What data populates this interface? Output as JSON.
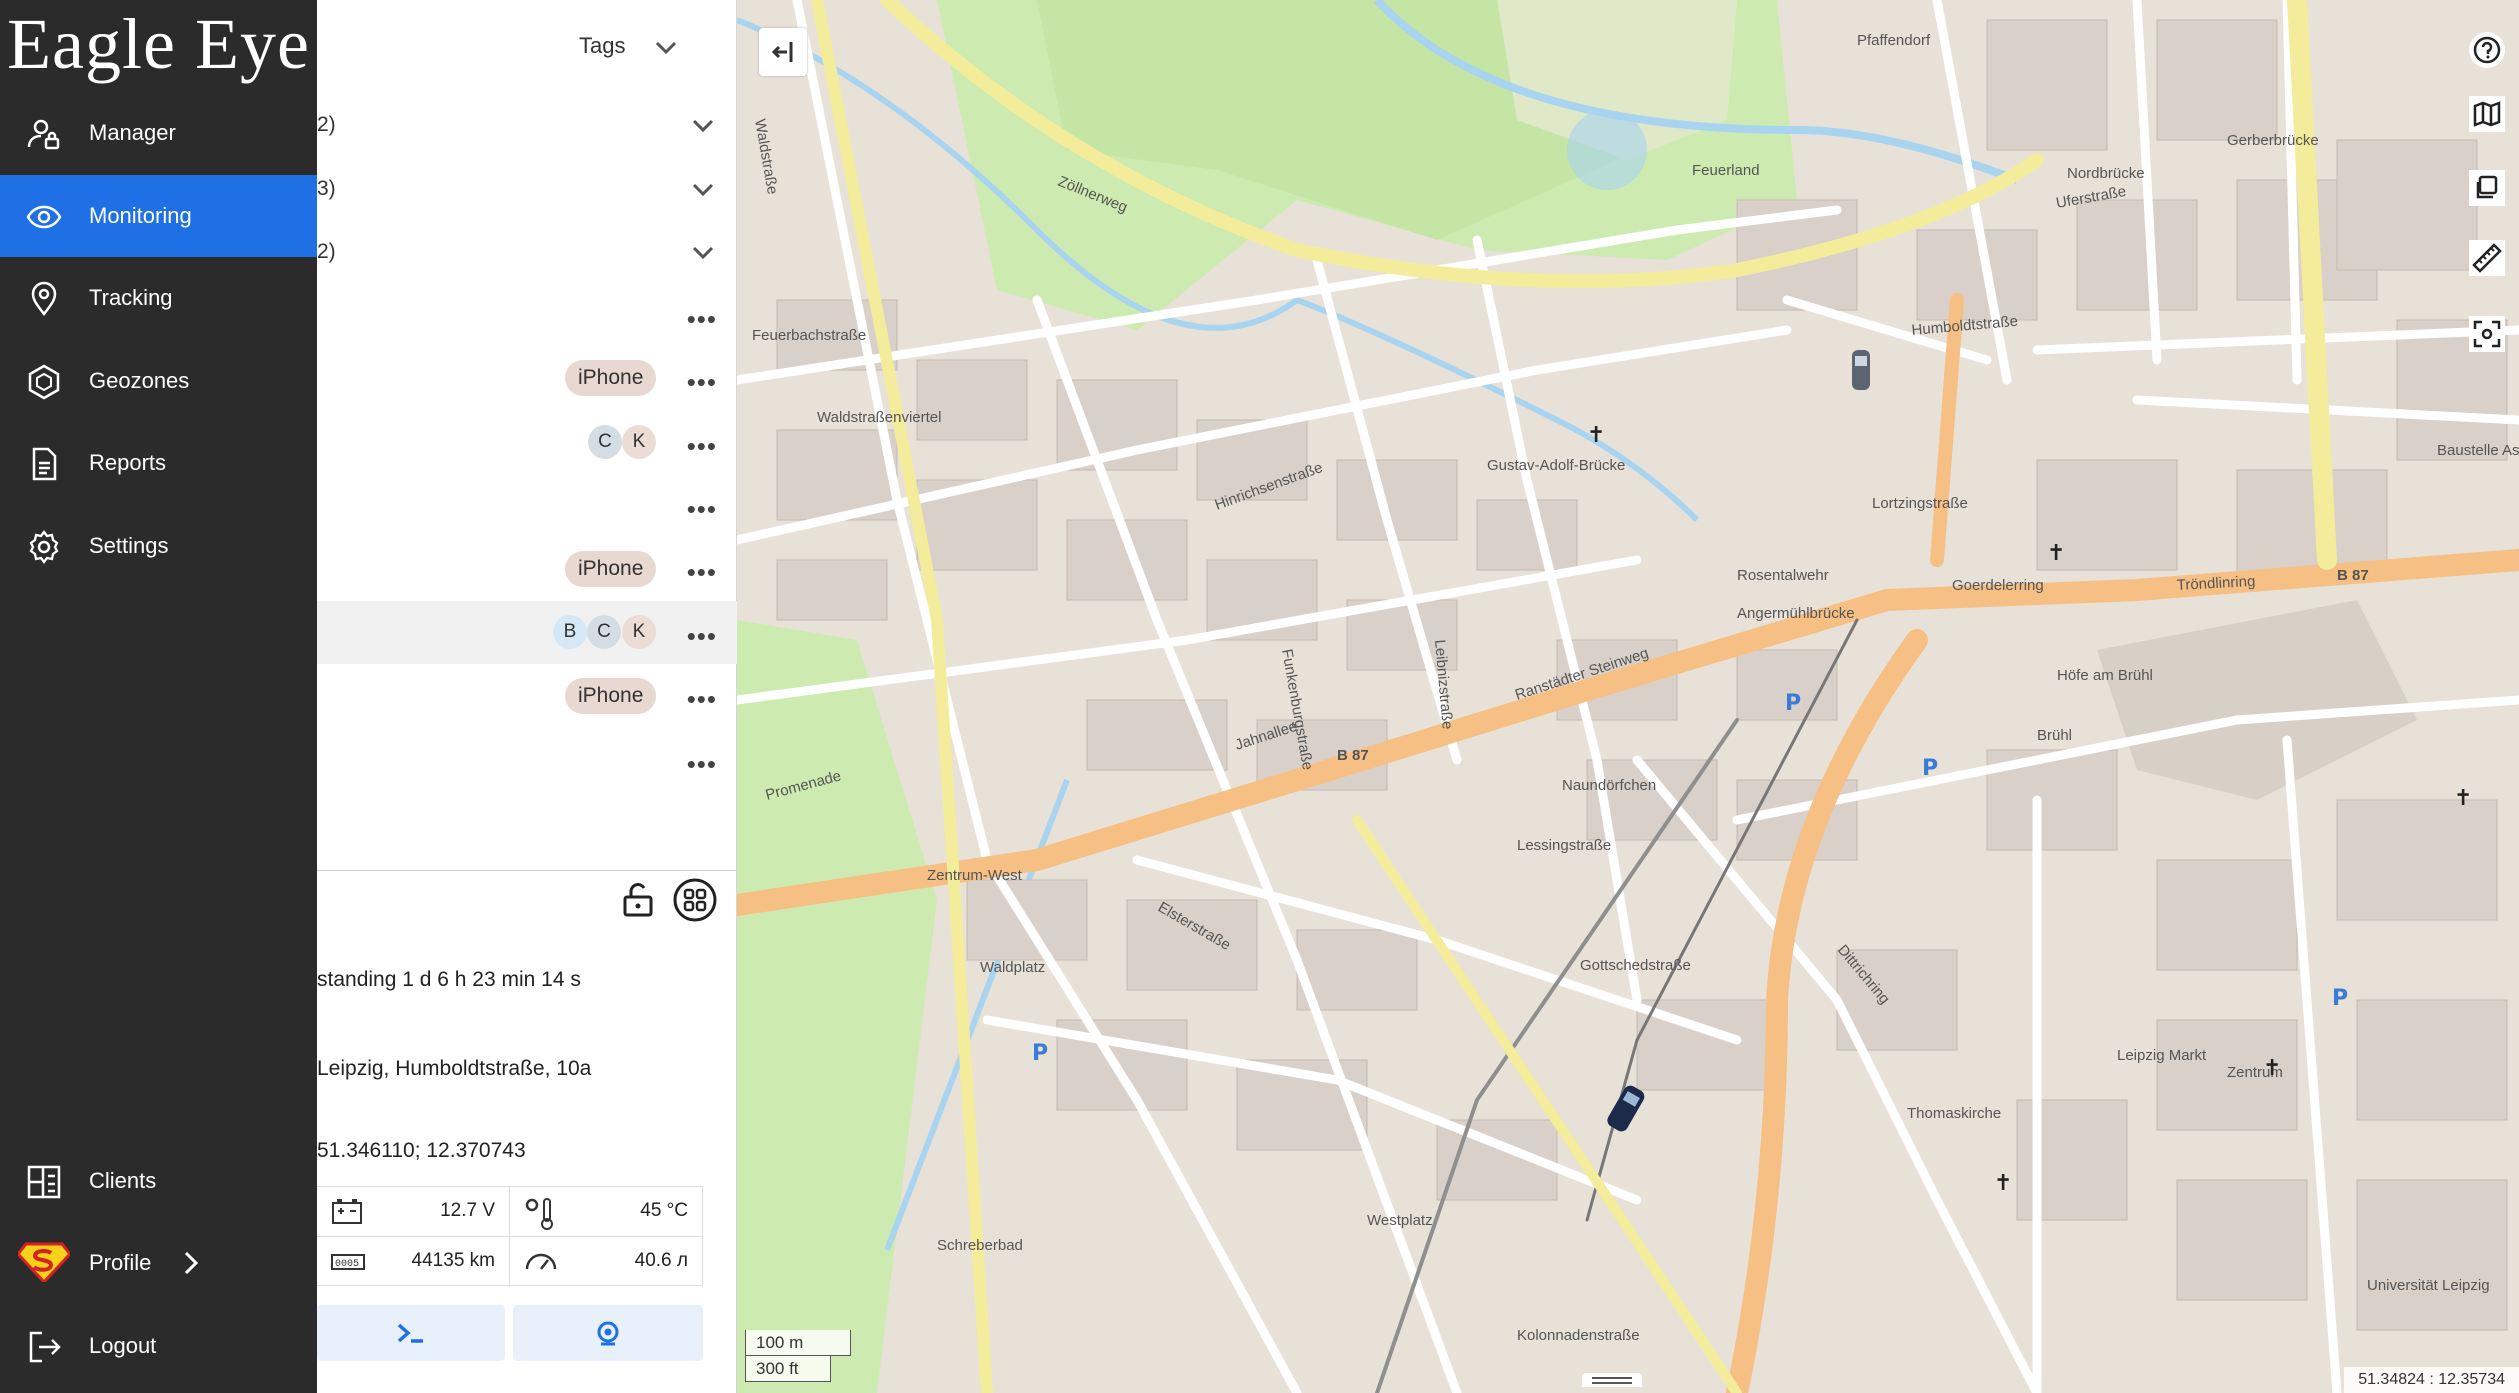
{
  "app": {
    "logo": "Eagle Eye"
  },
  "nav": {
    "items": [
      {
        "label": "Manager",
        "icon": "user-lock-icon"
      },
      {
        "label": "Monitoring",
        "icon": "eye-icon"
      },
      {
        "label": "Tracking",
        "icon": "map-pin-icon"
      },
      {
        "label": "Geozones",
        "icon": "hexagon-icon"
      },
      {
        "label": "Reports",
        "icon": "document-icon"
      },
      {
        "label": "Settings",
        "icon": "gear-icon"
      }
    ],
    "bottom": [
      {
        "label": "Clients",
        "icon": "clients-icon"
      },
      {
        "label": "Profile",
        "icon": "superman-avatar-icon"
      },
      {
        "label": "Logout",
        "icon": "logout-icon"
      }
    ],
    "active_color": "#1f6fe5"
  },
  "panel": {
    "tags_label": "Tags",
    "groups": [
      {
        "label": "2)"
      },
      {
        "label": "3)"
      },
      {
        "label": "2)"
      }
    ],
    "rows": [
      {
        "chips": []
      },
      {
        "chip": "iPhone"
      },
      {
        "avatars": [
          "C",
          "K"
        ]
      },
      {
        "chips": []
      },
      {
        "chip": "iPhone"
      },
      {
        "avatars": [
          "B",
          "C",
          "K"
        ],
        "selected": true
      },
      {
        "chip": "iPhone"
      },
      {
        "chips": []
      }
    ],
    "details": {
      "status": "standing 1 d 6 h 23 min 14 s",
      "address": "Leipzig, Humboldtstraße, 10a",
      "coords": "51.346110; 12.370743"
    },
    "metrics": {
      "voltage": "12.7 V",
      "temperature": "45 °C",
      "odometer": "44135 km",
      "fuel": "40.6 л"
    }
  },
  "map": {
    "scale_m": "100 m",
    "scale_ft": "300 ft",
    "cursor_coords": "51.34824 : 12.35734",
    "labels": {
      "zollnerweg": "Zöllnerweg",
      "waldstrassenviertel": "Waldstraßenviertel",
      "gustav_adolf_bruecke": "Gustav-Adolf-Brücke",
      "jahnallee": "Jahnallee",
      "b87": "B 87",
      "troendlinring": "Tröndlinring",
      "goerdelerring": "Goerdelerring",
      "leibnizstrasse": "Leibnizstraße",
      "zentrum": "Zentrum",
      "leipzig_markt": "Leipzig Markt",
      "thomaskirche": "Thomaskirche",
      "pfaffendorf": "Pfaffendorf",
      "feuerland": "Feuerland",
      "naundorfchen": "Naundörfchen",
      "waldplatz": "Waldplatz",
      "westplatz": "Westplatz",
      "gottschedstrasse": "Gottschedstraße",
      "dittrichring": "Dittrichring",
      "ranstaedter_steinweg": "Ranstädter Steinweg",
      "lessingstrasse": "Lessingstraße",
      "humboldtstrasse": "Humboldtstraße",
      "rosentalwehr": "Rosentalwehr",
      "lortzingstrasse": "Lortzingstraße",
      "bruehl": "Brühl",
      "gerberbruecke": "Gerberbrücke",
      "nordbruecke": "Nordbrücke",
      "uferstrasse": "Uferstraße",
      "feuerbachstrasse": "Feuerbachstraße",
      "universitaet": "Universität Leipzig",
      "kolonnadenstrasse": "Kolonnadenstraße",
      "schreberbad": "Schreberbad",
      "promenade": "Promenade",
      "hofe_am_bruehl": "Höfe am Brühl",
      "baustelle_astoria": "Baustelle Astoria",
      "waldstrasse": "Waldstraße",
      "zentrum_west": "Zentrum-West",
      "angermuehlbruecke": "Angermühlbrücke",
      "hinrichsenstrasse": "Hinrichsenstraße",
      "funkenburgstrasse": "Funkenburgstraße",
      "elsterstrasse": "Elsterstraße"
    }
  }
}
